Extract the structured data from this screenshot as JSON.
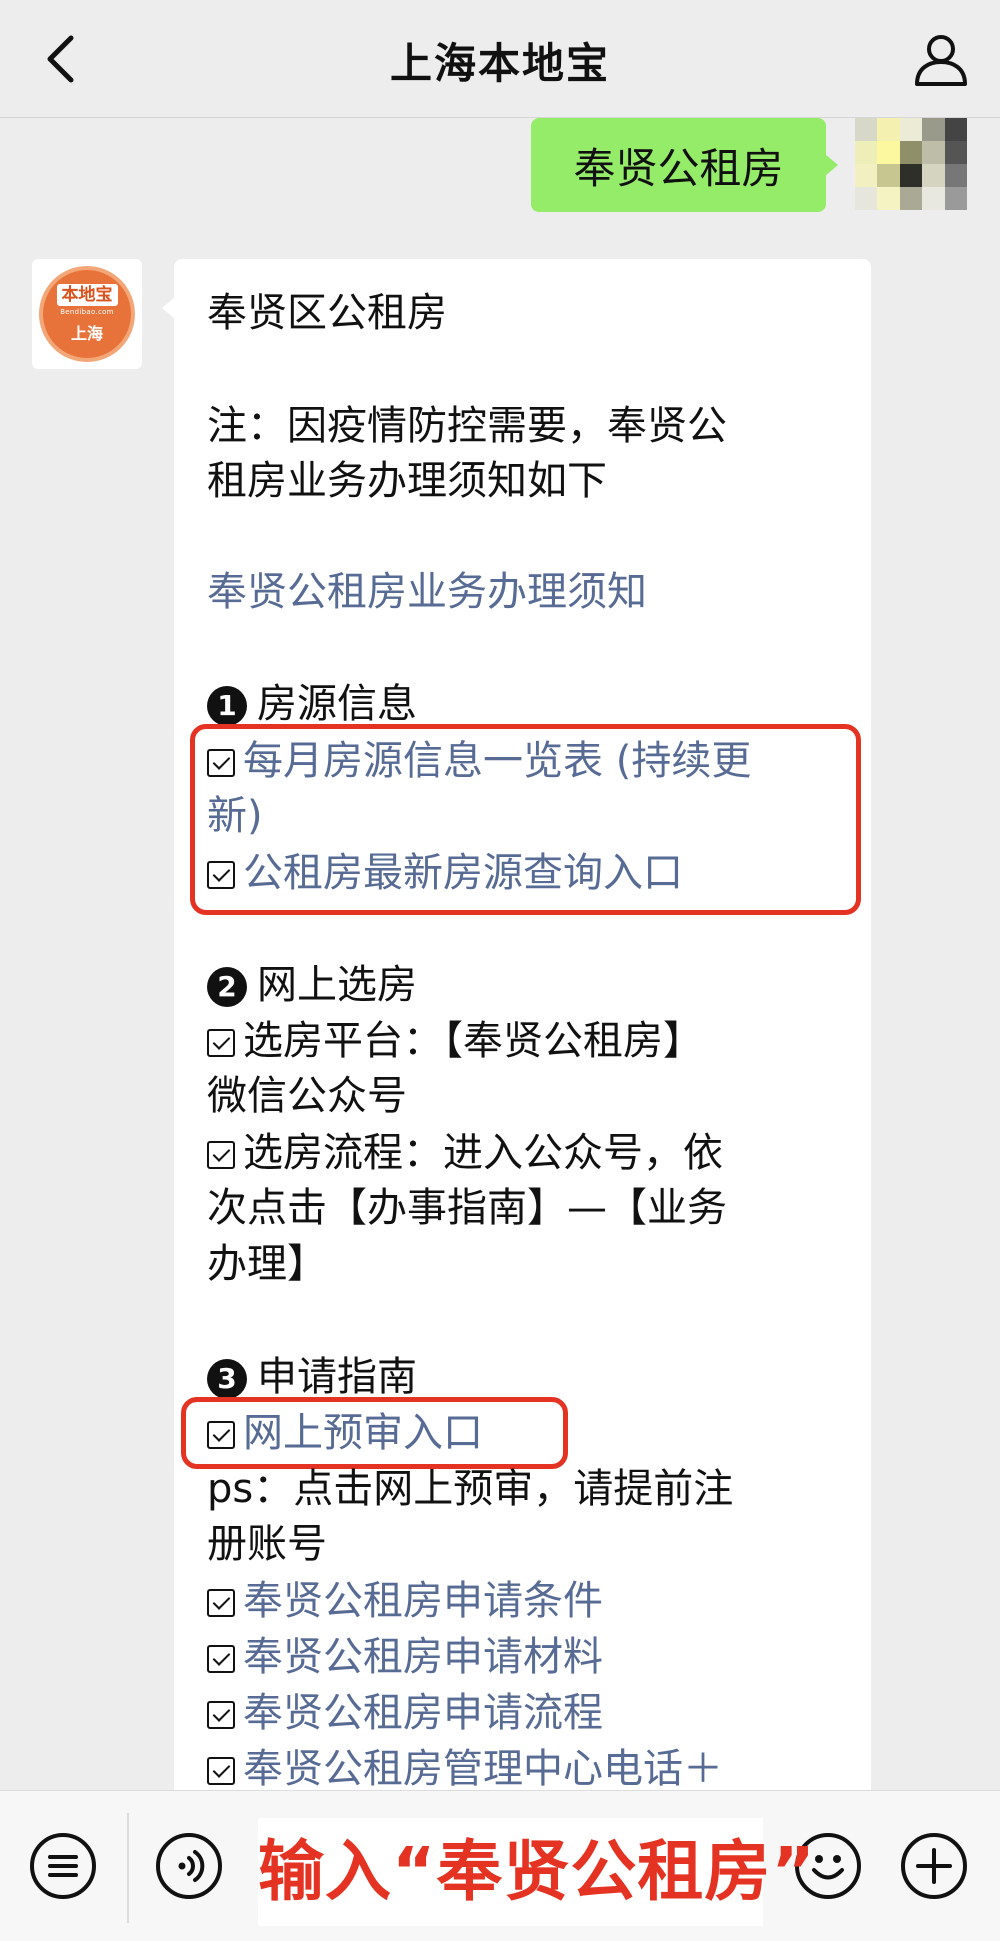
{
  "header": {
    "title": "上海本地宝"
  },
  "outgoing": {
    "text": "奉贤公租房"
  },
  "bot": {
    "logo_name": "本地宝",
    "logo_domain": "Bendibao.com",
    "logo_city": "上海"
  },
  "message": {
    "title": "奉贤区公租房",
    "note_line1": "注：因疫情防控需要，奉贤公",
    "note_line2": "租房业务办理须知如下",
    "notice_link": "奉贤公租房业务办理须知",
    "sections": [
      {
        "number": "1",
        "title": "房源信息",
        "items": [
          {
            "text_line1": "每月房源信息一览表 (持续更",
            "text_line2": "新)"
          },
          {
            "text": "公租房最新房源查询入口"
          }
        ]
      },
      {
        "number": "2",
        "title": "网上选房",
        "lines": [
          "选房平台：【奉贤公租房】",
          "微信公众号",
          "选房流程：进入公众号，依",
          "次点击【办事指南】—【业务",
          "办理】"
        ]
      },
      {
        "number": "3",
        "title": "申请指南",
        "preaudit_link": "网上预审入口",
        "ps_line1": "ps：点击网上预审，请提前注",
        "ps_line2": "册账号",
        "links": [
          "奉贤公租房申请条件",
          "奉贤公租房申请材料",
          "奉贤公租房申请流程",
          "奉贤公租房管理中心电话＋"
        ]
      }
    ]
  },
  "input_hint": "输入“奉贤公租房”",
  "colors": {
    "link": "#576b95",
    "outgoing_bubble": "#95ec69",
    "highlight_red": "#e53323",
    "logo_orange": "#e8733a"
  },
  "icons": [
    "back-icon",
    "profile-icon",
    "menu-icon",
    "voice-icon",
    "emoji-icon",
    "plus-icon"
  ]
}
